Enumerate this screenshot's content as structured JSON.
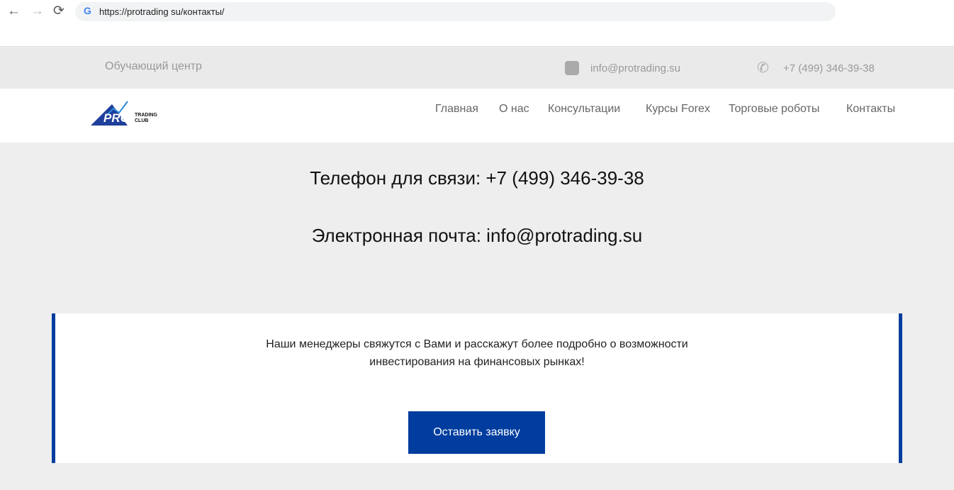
{
  "browser": {
    "url": "https://protrading su/контакты/",
    "back": "←",
    "forward": "→",
    "reload": "⟳",
    "google": "G"
  },
  "topbar": {
    "tagline": "Обучающий центр",
    "email": "info@protrading.su",
    "phone": "+7 (499) 346-39-38"
  },
  "logo": {
    "text": "PRO",
    "sub1": "TRADING",
    "sub2": "CLUB"
  },
  "menu": [
    "Главная",
    "О нас",
    "Консультации",
    "Курсы Forex",
    "Торговые роботы",
    "Контакты"
  ],
  "contacts": {
    "phone_line": "Телефон для связи: +7 (499) 346-39-38",
    "email_line": "Электронная почта: info@protrading.su"
  },
  "cta": {
    "line1": "Наши менеджеры свяжутся с Вами и расскажут более подробно о возможности",
    "line2": "инвестирования на финансовых рынках!",
    "button": "Оставить заявку"
  },
  "colors": {
    "accent": "#003d9e"
  }
}
